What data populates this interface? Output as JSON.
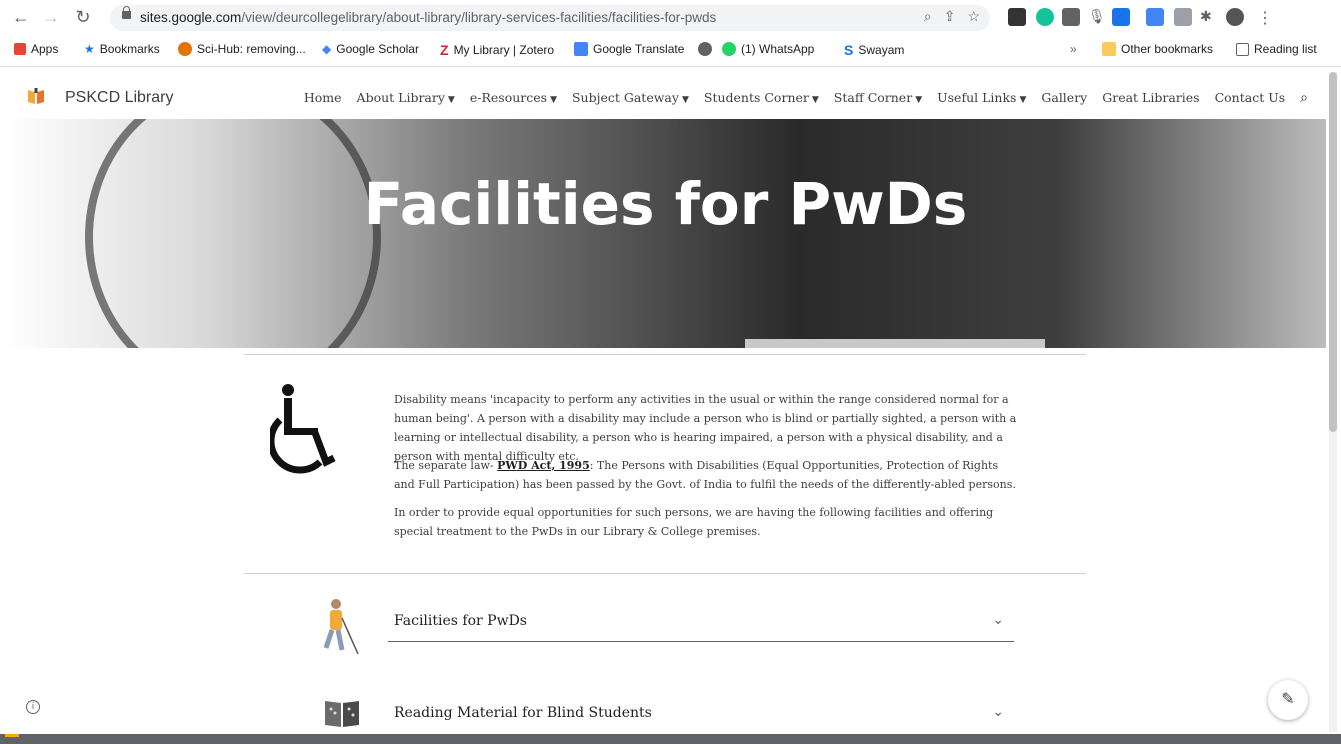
{
  "browser": {
    "url_domain": "sites.google.com",
    "url_path": "/view/deurcollegelibrary/about-library/library-services-facilities/facilities-for-pwds",
    "bookmarks": [
      "Apps",
      "Bookmarks",
      "Sci-Hub: removing...",
      "Google Scholar",
      "My Library | Zotero",
      "Google Translate",
      "(1) WhatsApp",
      "Swayam"
    ],
    "overflow": "»",
    "other_bookmarks": "Other bookmarks",
    "reading_list": "Reading list"
  },
  "site": {
    "name": "PSKCD Library",
    "menu": [
      {
        "label": "Home",
        "dropdown": false
      },
      {
        "label": "About Library",
        "dropdown": true
      },
      {
        "label": "e-Resources",
        "dropdown": true
      },
      {
        "label": "Subject Gateway",
        "dropdown": true
      },
      {
        "label": "Students Corner",
        "dropdown": true
      },
      {
        "label": "Staff Corner",
        "dropdown": true
      },
      {
        "label": "Useful Links",
        "dropdown": true
      },
      {
        "label": "Gallery",
        "dropdown": false
      },
      {
        "label": "Great Libraries",
        "dropdown": false
      },
      {
        "label": "Contact Us",
        "dropdown": false
      }
    ]
  },
  "hero": {
    "title": "Facilities for PwDs"
  },
  "content": {
    "p1": "Disability means 'incapacity to perform any activities in the usual or within the range considered normal for a human being'. A person with a disability may include a person who is blind or partially sighted, a person with a learning or intellectual disability, a person who is hearing impaired, a person with a physical disability, and a person with mental difficulty etc.",
    "p2_pre": "The separate law- ",
    "p2_link": "PWD Act, 1995",
    "p2_post": ": The Persons with Disabilities (Equal Opportunities, Protection of Rights and Full Participation) has been passed by the Govt. of India to fulfil the needs of the differently-abled persons.",
    "p3": "In order to provide equal opportunities for such persons, we are having the following facilities and offering special treatment to the PwDs in our Library & College premises."
  },
  "accordion": [
    {
      "label": "Facilities for PwDs",
      "icon": "blind-person-icon"
    },
    {
      "label": "Reading Material for Blind Students",
      "icon": "braille-book-icon"
    }
  ],
  "colors": {
    "accent": "#202124",
    "grey": "#5f6368"
  }
}
